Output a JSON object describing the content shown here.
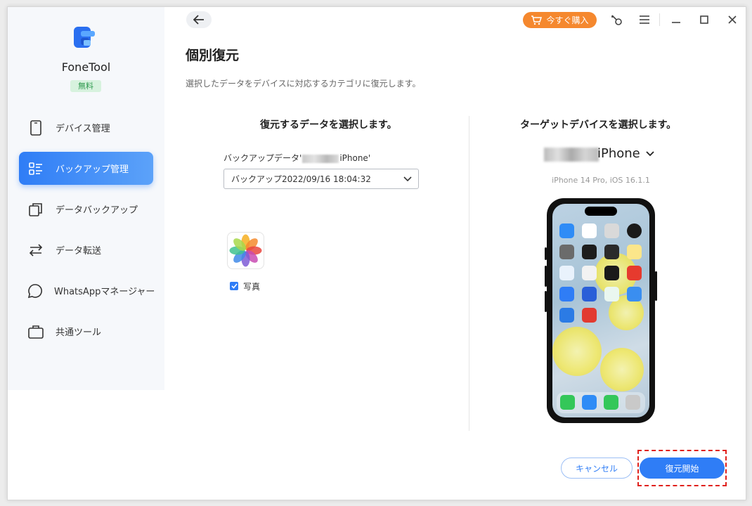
{
  "app": {
    "name": "FoneTool",
    "badge": "無料"
  },
  "sidebar": {
    "items": [
      {
        "label": "デバイス管理",
        "icon": "phone-icon"
      },
      {
        "label": "バックアップ管理",
        "icon": "list-icon"
      },
      {
        "label": "データバックアップ",
        "icon": "copy-icon"
      },
      {
        "label": "データ転送",
        "icon": "transfer-icon"
      },
      {
        "label": "WhatsAppマネージャー",
        "icon": "chat-bubble-icon"
      },
      {
        "label": "共通ツール",
        "icon": "toolbox-icon"
      }
    ],
    "active_index": 1
  },
  "header": {
    "buy_label": "今すぐ購入"
  },
  "page": {
    "title": "個別復元",
    "description": "選択したデータをデバイスに対応するカテゴリに復元します。"
  },
  "source": {
    "section_title": "復元するデータを選択します。",
    "backup_label_prefix": "バックアップデータ'",
    "backup_label_suffix": "iPhone'",
    "selected_backup": "バックアップ2022/09/16 18:04:32",
    "category_label": "写真",
    "category_checked": true
  },
  "target": {
    "section_title": "ターゲットデバイスを選択します。",
    "device_name": "iPhone",
    "device_info": "iPhone 14 Pro, iOS 16.1.1"
  },
  "footer": {
    "cancel_label": "キャンセル",
    "start_label": "復元開始"
  },
  "colors": {
    "accent": "#2f7df6",
    "buy": "#f5882e",
    "highlight": "#e0201b"
  }
}
